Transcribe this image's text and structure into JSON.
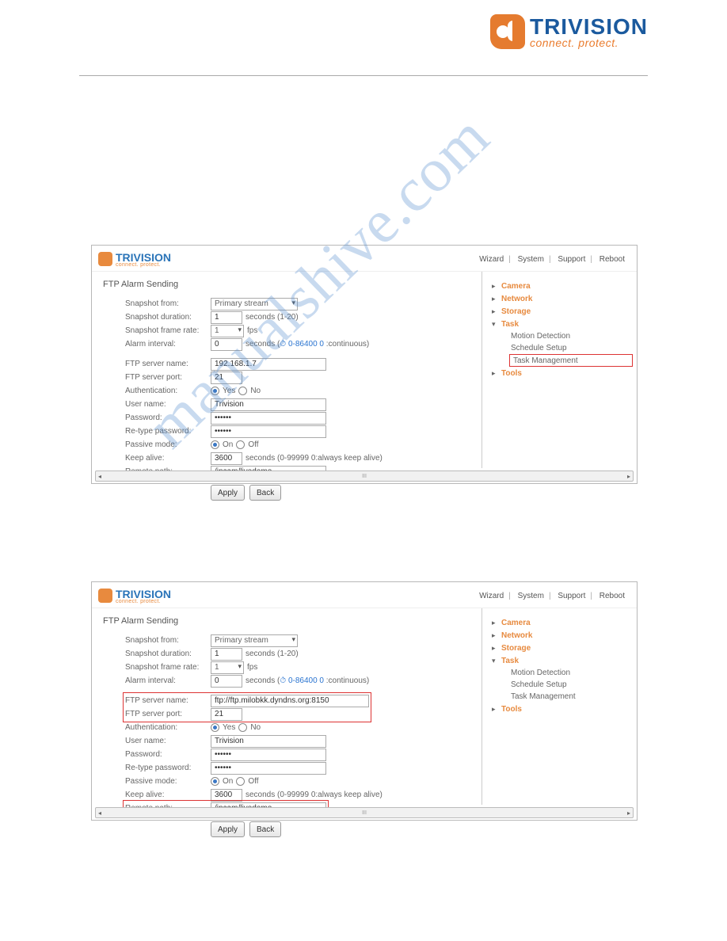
{
  "brand": {
    "name": "TRIVISION",
    "tagline": "connect. protect."
  },
  "watermark": "manualshive.com",
  "topLinks": {
    "wizard": "Wizard",
    "system": "System",
    "support": "Support",
    "reboot": "Reboot"
  },
  "sectionTitle": "FTP Alarm Sending",
  "labels": {
    "snapshotFrom": "Snapshot from:",
    "snapshotDuration": "Snapshot duration:",
    "snapshotFrameRate": "Snapshot frame rate:",
    "alarmInterval": "Alarm interval:",
    "ftpServerName": "FTP server name:",
    "ftpServerPort": "FTP server port:",
    "authentication": "Authentication:",
    "userName": "User name:",
    "password": "Password:",
    "retypePassword": "Re-type password:",
    "passiveMode": "Passive mode:",
    "keepAlive": "Keep alive:",
    "remotePath": "Remote path:"
  },
  "hints": {
    "durationUnit": "seconds (1-20)",
    "fps": "fps",
    "alarmPrefix": "seconds (",
    "alarmRange": "0-86400 0",
    "alarmSuffix": " :continuous)",
    "keepAlive": "seconds (0-99999 0:always keep alive)",
    "yes": "Yes",
    "no": "No",
    "on": "On",
    "off": "Off"
  },
  "buttons": {
    "apply": "Apply",
    "back": "Back"
  },
  "sidebar": {
    "camera": "Camera",
    "network": "Network",
    "storage": "Storage",
    "task": "Task",
    "motionDetection": "Motion Detection",
    "scheduleSetup": "Schedule Setup",
    "taskManagement": "Task Management",
    "tools": "Tools"
  },
  "shot1": {
    "snapshotFrom": "Primary stream",
    "duration": "1",
    "frameRate": "1",
    "alarmInterval": "0",
    "ftpServer": "192.168.1.7",
    "ftpPort": "21",
    "userName": "Trivision",
    "password": "••••••",
    "retype": "••••••",
    "keepAlive": "3600",
    "remotePath": "/ipcam/livedemo"
  },
  "shot2": {
    "snapshotFrom": "Primary stream",
    "duration": "1",
    "frameRate": "1",
    "alarmInterval": "0",
    "ftpServer": "ftp://ftp.milobkk.dyndns.org:8150",
    "ftpPort": "21",
    "userName": "Trivision",
    "password": "••••••",
    "retype": "••••••",
    "keepAlive": "3600",
    "remotePath": "/ipcam/livedemo"
  }
}
